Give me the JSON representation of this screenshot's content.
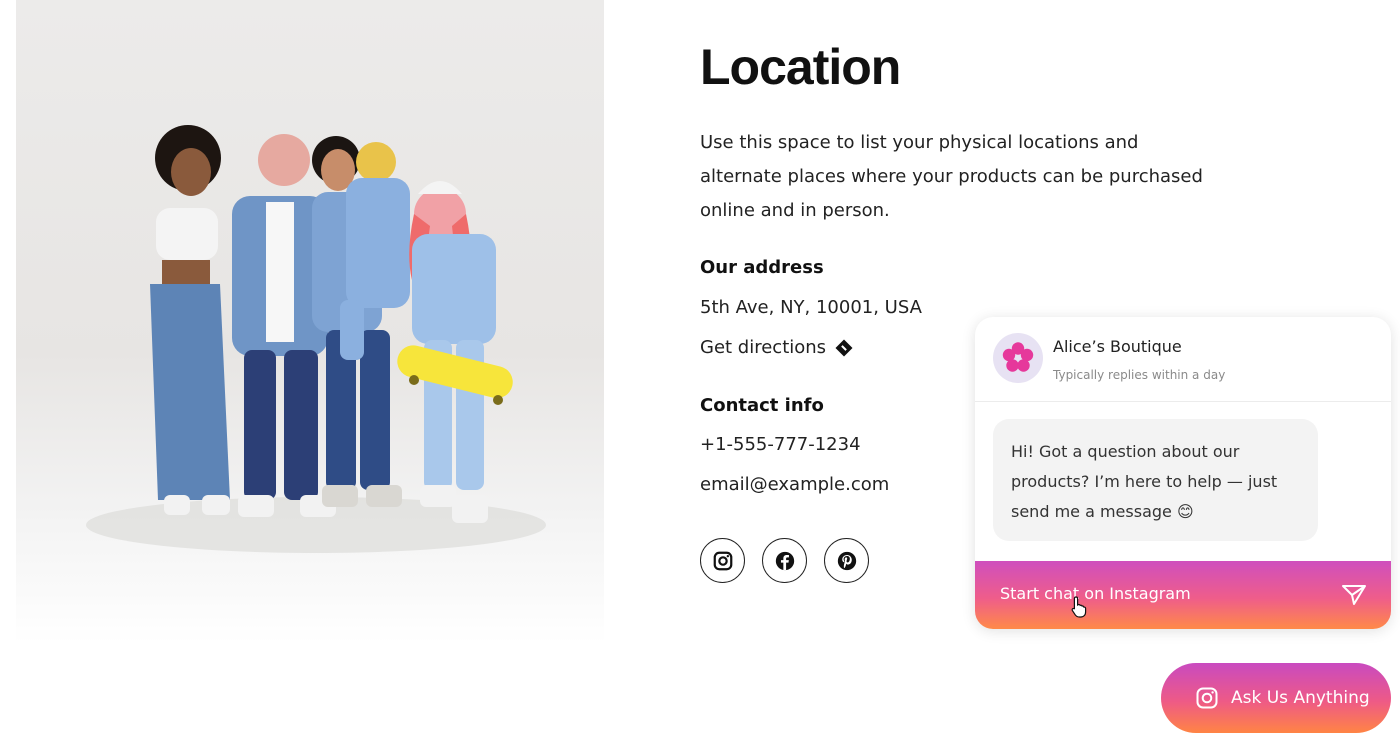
{
  "location": {
    "title": "Location",
    "description_lines": [
      "Use this space to list your physical locations and",
      "alternate places where your products can be purchased",
      "online and in person."
    ],
    "address_heading": "Our address",
    "address": "5th Ave, NY, 10001, USA",
    "directions_label": "Get directions",
    "contact_heading": "Contact info",
    "phone": "+1-555-777-1234",
    "email": "email@example.com",
    "social_icons": [
      "instagram-icon",
      "facebook-icon",
      "pinterest-icon"
    ]
  },
  "chat_widget": {
    "shop_name": "Alice’s Boutique",
    "reply_time": "Typically replies within a day",
    "message_lines": [
      "Hi! Got a question about our",
      "products? I’m here to help — just",
      "send me a message 😊"
    ],
    "start_chat_label": "Start chat on Instagram"
  },
  "ask_button": {
    "label": "Ask Us Anything"
  },
  "colors": {
    "gradient_top": "#cf4fbe",
    "gradient_mid": "#ef5d8a",
    "gradient_bottom": "#ff8a48",
    "avatar_flower": "#e6389b",
    "avatar_bg": "#e7e2f3"
  }
}
